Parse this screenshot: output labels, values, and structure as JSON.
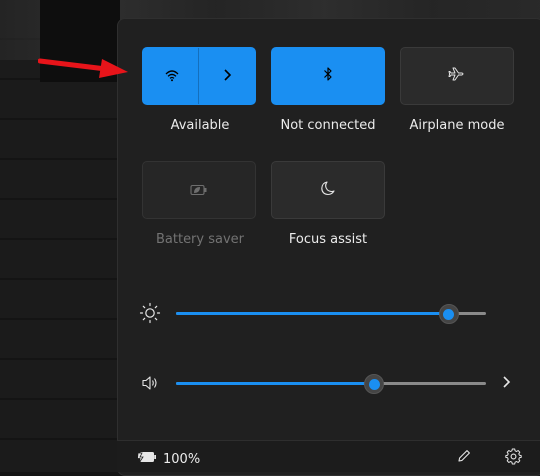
{
  "quick_settings": {
    "tiles": [
      {
        "id": "wifi",
        "label": "Available",
        "state": "on",
        "icon": "wifi-icon",
        "expand_icon": "chevron-right-icon"
      },
      {
        "id": "bluetooth",
        "label": "Not connected",
        "state": "on",
        "icon": "bluetooth-icon"
      },
      {
        "id": "airplane",
        "label": "Airplane mode",
        "state": "off",
        "icon": "airplane-icon"
      },
      {
        "id": "battery_saver",
        "label": "Battery saver",
        "state": "disabled",
        "icon": "battery-saver-icon"
      },
      {
        "id": "focus_assist",
        "label": "Focus assist",
        "state": "off",
        "icon": "moon-icon"
      }
    ],
    "brightness": {
      "icon": "brightness-icon",
      "value_percent": 88
    },
    "volume": {
      "icon": "speaker-icon",
      "value_percent": 64,
      "expand_icon": "chevron-right-icon"
    }
  },
  "footer": {
    "battery_text": "100%",
    "battery_icon": "battery-charging-icon",
    "edit_icon": "pencil-icon",
    "settings_icon": "gear-icon"
  },
  "annotation": {
    "arrow_color": "#e8141a"
  },
  "colors": {
    "accent": "#1a8ff2",
    "panel": "#202020",
    "tile_off": "#2b2b2b"
  }
}
